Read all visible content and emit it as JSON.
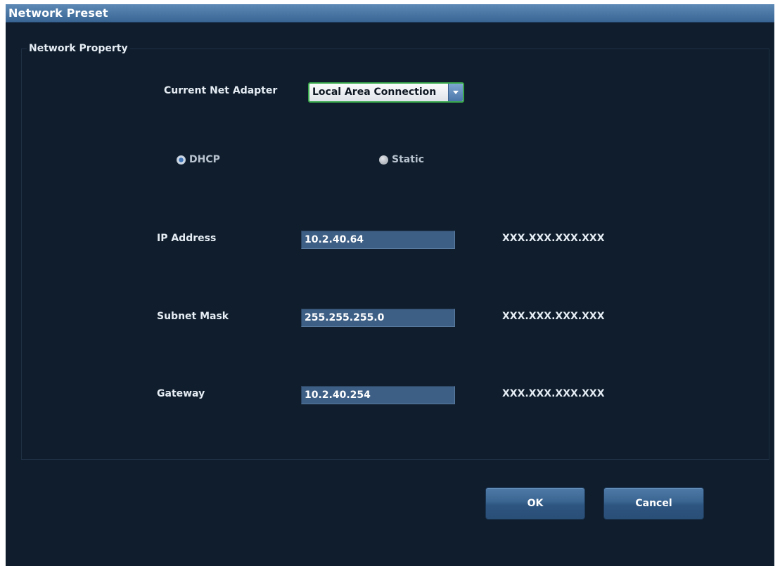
{
  "window": {
    "title": "Network Preset"
  },
  "network_property": {
    "group_title": "Network Property",
    "adapter": {
      "label": "Current Net Adapter",
      "selected": "Local Area Connection"
    },
    "mode": {
      "options": [
        {
          "label": "DHCP",
          "checked": true
        },
        {
          "label": "Static",
          "checked": false
        }
      ]
    },
    "fields": {
      "ip": {
        "label": "IP Address",
        "value": "10.2.40.64",
        "format_hint": "XXX.XXX.XXX.XXX"
      },
      "subnet": {
        "label": "Subnet Mask",
        "value": "255.255.255.0",
        "format_hint": "XXX.XXX.XXX.XXX"
      },
      "gateway": {
        "label": "Gateway",
        "value": "10.2.40.254",
        "format_hint": "XXX.XXX.XXX.XXX"
      }
    }
  },
  "buttons": {
    "ok_label": "OK",
    "cancel_label": "Cancel"
  },
  "colors": {
    "background": "#0f1d2c",
    "titlebar": "#4a77a6",
    "field": "#3e5f85",
    "focus_border": "#39a84c"
  }
}
